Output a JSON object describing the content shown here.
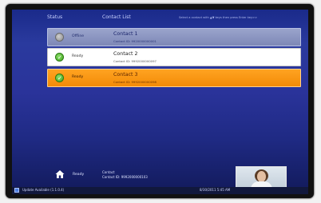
{
  "header": {
    "status_col": "Status",
    "contact_col": "Contact List",
    "hint": "Select a contact with ▲▼ keys then press Enter key>>"
  },
  "contacts": [
    {
      "name": "Contact 1",
      "id_line": "Contact ID: 9920000000001",
      "status": "Offline",
      "status_icon": "offline-icon"
    },
    {
      "name": "Contact 2",
      "id_line": "Contact ID: 9992000000097",
      "status": "Ready",
      "status_icon": "ready-check-icon"
    },
    {
      "name": "Contact 3",
      "id_line": "Contact ID: 9992000000098",
      "status": "Ready",
      "status_icon": "ready-check-icon"
    }
  ],
  "self_panel": {
    "status": "Ready",
    "contact_label": "Contact",
    "contact_id_line": "Contact ID: 9992000000103"
  },
  "statusbar": {
    "update_text": "Update Available (1.1.0.4)",
    "datetime": "8/30/2011 5:45 AM"
  },
  "colors": {
    "background": "#2a3a9e",
    "selected_row": "#f38b07",
    "ready": "#3da31a"
  }
}
